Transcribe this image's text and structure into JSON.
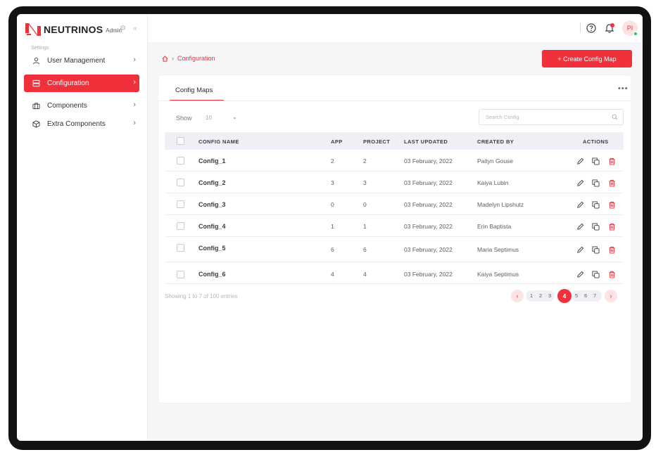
{
  "app": {
    "brand": "NEUTRINOS",
    "brand_sub": "Admin"
  },
  "sidebar": {
    "section_label": "Settings",
    "items": [
      {
        "label": "User Management",
        "icon": "user-icon"
      },
      {
        "label": "Configuration",
        "icon": "server-icon",
        "active": true
      },
      {
        "label": "Components",
        "icon": "briefcase-icon"
      },
      {
        "label": "Extra Components",
        "icon": "cube-icon"
      }
    ]
  },
  "header": {
    "avatar_initials": "PI"
  },
  "breadcrumb": {
    "current": "Configuration"
  },
  "toolbar": {
    "create_label": "+ Create Config Map"
  },
  "card": {
    "tab_label": "Config Maps",
    "more_label": "•••",
    "show_label": "Show",
    "show_value": "10",
    "search_placeholder": "Search Config"
  },
  "table": {
    "columns": [
      "CONFIG NAME",
      "APP",
      "PROJECT",
      "LAST UPDATED",
      "CREATED BY",
      "ACTIONS"
    ],
    "rows": [
      {
        "name": "Config_1",
        "app": "2",
        "project": "2",
        "updated": "03 February, 2022",
        "created_by": "Paityn Gouse"
      },
      {
        "name": "Config_2",
        "app": "3",
        "project": "3",
        "updated": "03 February, 2022",
        "created_by": "Kaiya Lubin"
      },
      {
        "name": "Config_3",
        "app": "0",
        "project": "0",
        "updated": "03 February, 2022",
        "created_by": "Madelyn Lipshutz"
      },
      {
        "name": "Config_4",
        "app": "1",
        "project": "1",
        "updated": "03 February, 2022",
        "created_by": "Erin Baptista"
      },
      {
        "name": "Config_5",
        "app": "6",
        "project": "6",
        "updated": "03 February, 2022",
        "created_by": "Maria Septimus"
      },
      {
        "name": "Config_6",
        "app": "4",
        "project": "4",
        "updated": "03 February, 2022",
        "created_by": "Kaiya Septimus"
      }
    ]
  },
  "footer": {
    "showing_text": "Showing 1 to 7 of 100 entries"
  },
  "pagination": {
    "prev": "‹",
    "next": "›",
    "pages": [
      "1",
      "2",
      "3",
      "4",
      "5",
      "6",
      "7"
    ],
    "current": "4"
  },
  "colors": {
    "accent": "#f0303a",
    "online": "#22c55e"
  }
}
